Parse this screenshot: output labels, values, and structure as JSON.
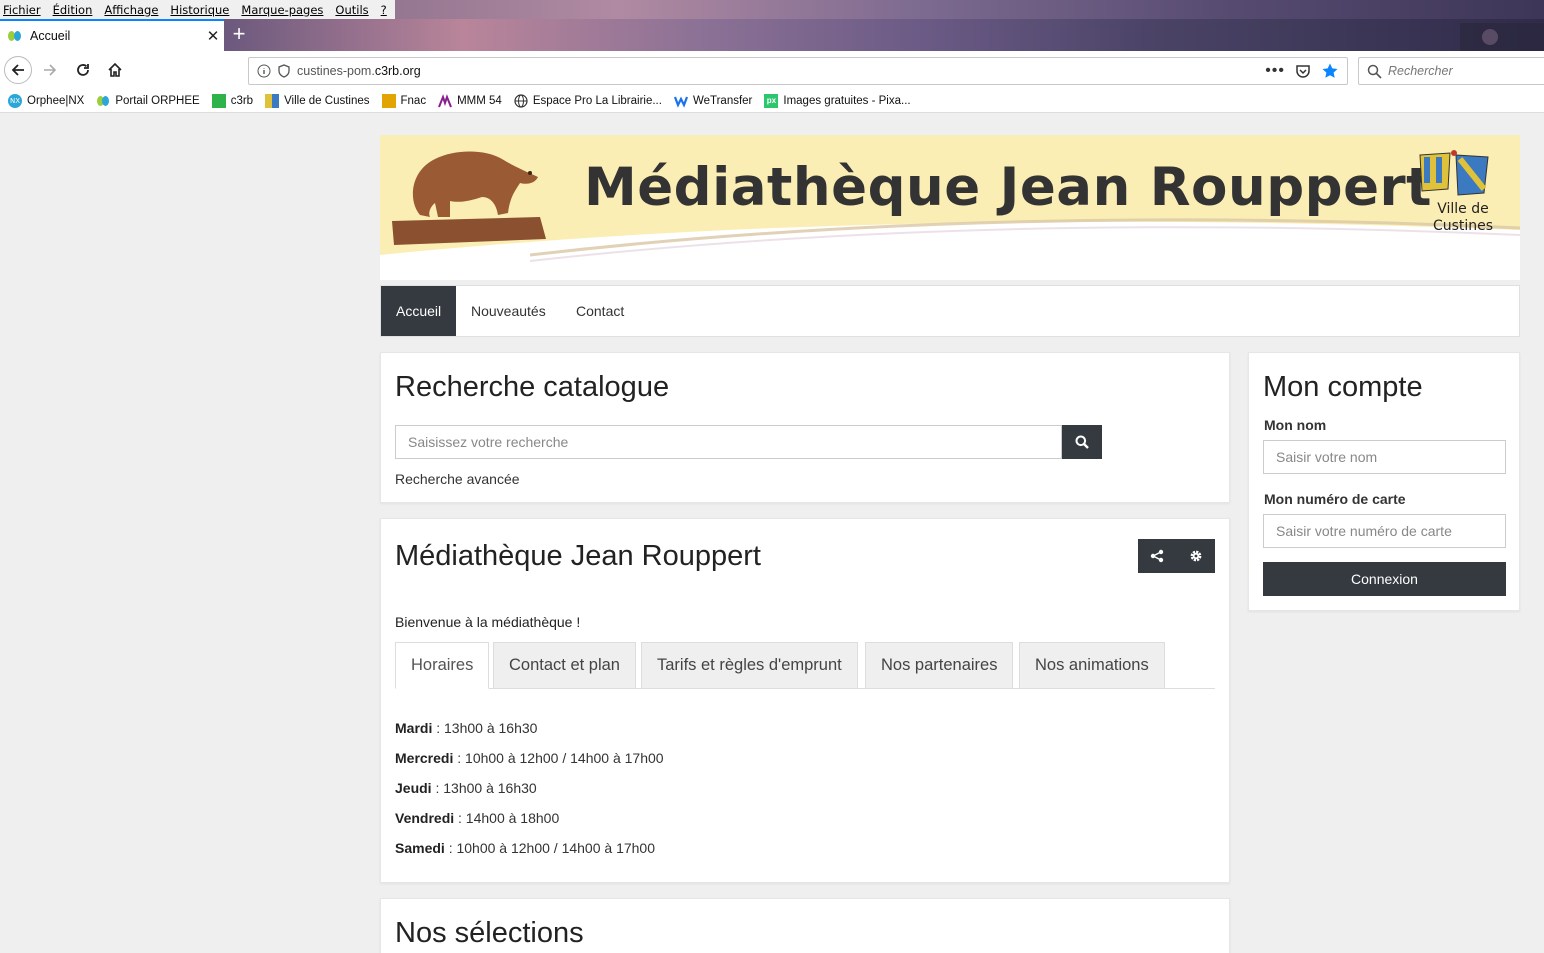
{
  "browser": {
    "menu": [
      "Fichier",
      "Édition",
      "Affichage",
      "Historique",
      "Marque-pages",
      "Outils",
      "?"
    ],
    "tab_title": "Accueil",
    "url_host": "custines-pom.",
    "url_domain": "c3rb.org",
    "search_placeholder": "Rechercher",
    "bookmarks": [
      {
        "label": "Orphee|NX",
        "icon": "orphee-nx-icon"
      },
      {
        "label": "Portail ORPHEE",
        "icon": "orphee-portal-icon"
      },
      {
        "label": "c3rb",
        "icon": "c3rb-icon"
      },
      {
        "label": "Ville de Custines",
        "icon": "custines-icon"
      },
      {
        "label": "Fnac",
        "icon": "fnac-icon"
      },
      {
        "label": "MMM 54",
        "icon": "mmm-icon"
      },
      {
        "label": "Espace Pro La Librairie...",
        "icon": "globe-icon"
      },
      {
        "label": "WeTransfer",
        "icon": "wetransfer-icon"
      },
      {
        "label": "Images gratuites - Pixa...",
        "icon": "pixabay-icon"
      }
    ],
    "bookmark_icon_text": {
      "nx": "NX",
      "px": "px"
    }
  },
  "banner": {
    "title": "Médiathèque Jean Rouppert",
    "ville_line1": "Ville de",
    "ville_line2": "Custines"
  },
  "nav": {
    "items": [
      "Accueil",
      "Nouveautés",
      "Contact"
    ],
    "active_index": 0
  },
  "search": {
    "title": "Recherche catalogue",
    "placeholder": "Saisissez votre recherche",
    "advanced": "Recherche avancée"
  },
  "media": {
    "title": "Médiathèque Jean Rouppert",
    "welcome": "Bienvenue à la médiathèque !",
    "tabs": [
      "Horaires",
      "Contact et plan",
      "Tarifs et règles d'emprunt",
      "Nos partenaires",
      "Nos animations"
    ],
    "active_tab": 0,
    "hours": [
      {
        "day": "Mardi",
        "time": " : 13h00 à 16h30"
      },
      {
        "day": "Mercredi",
        "time": " : 10h00 à 12h00 / 14h00 à 17h00"
      },
      {
        "day": "Jeudi",
        "time": " : 13h00 à 16h30"
      },
      {
        "day": "Vendredi",
        "time": " : 14h00 à 18h00"
      },
      {
        "day": "Samedi",
        "time": " : 10h00 à 12h00 / 14h00 à 17h00"
      }
    ]
  },
  "selections": {
    "title": "Nos sélections"
  },
  "account": {
    "title": "Mon compte",
    "name_label": "Mon nom",
    "name_placeholder": "Saisir votre nom",
    "card_label": "Mon numéro de carte",
    "card_placeholder": "Saisir votre numéro de carte",
    "login": "Connexion"
  },
  "colors": {
    "dark": "#343a40",
    "banner_bg": "#fbeeb4",
    "page_bg": "#efefef",
    "firefox_blue": "#0a84ff"
  }
}
